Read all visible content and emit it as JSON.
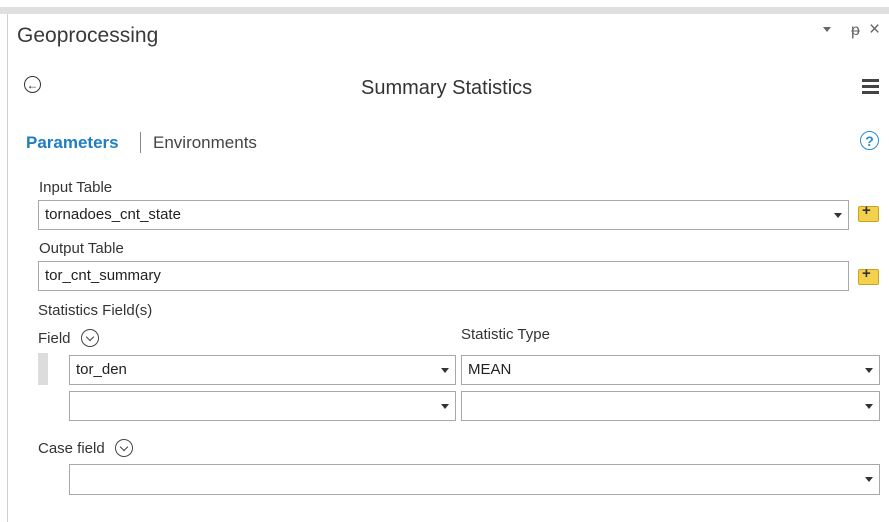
{
  "pane": {
    "title": "Geoprocessing",
    "pin_icon": "pin-icon",
    "close_icon": "close-icon",
    "close_glyph": "×",
    "pin_glyph": "ᵽ"
  },
  "tool": {
    "title": "Summary Statistics"
  },
  "tabs": {
    "parameters": "Parameters",
    "environments": "Environments"
  },
  "help": "?",
  "input_table": {
    "label": "Input Table",
    "value": "tornadoes_cnt_state"
  },
  "output_table": {
    "label": "Output Table",
    "value": "tor_cnt_summary"
  },
  "stats": {
    "label": "Statistics Field(s)",
    "field_label": "Field",
    "stat_type_label": "Statistic Type",
    "rows": [
      {
        "field": "tor_den",
        "stat": "MEAN"
      },
      {
        "field": "",
        "stat": ""
      }
    ]
  },
  "case_field": {
    "label": "Case field",
    "value": ""
  }
}
